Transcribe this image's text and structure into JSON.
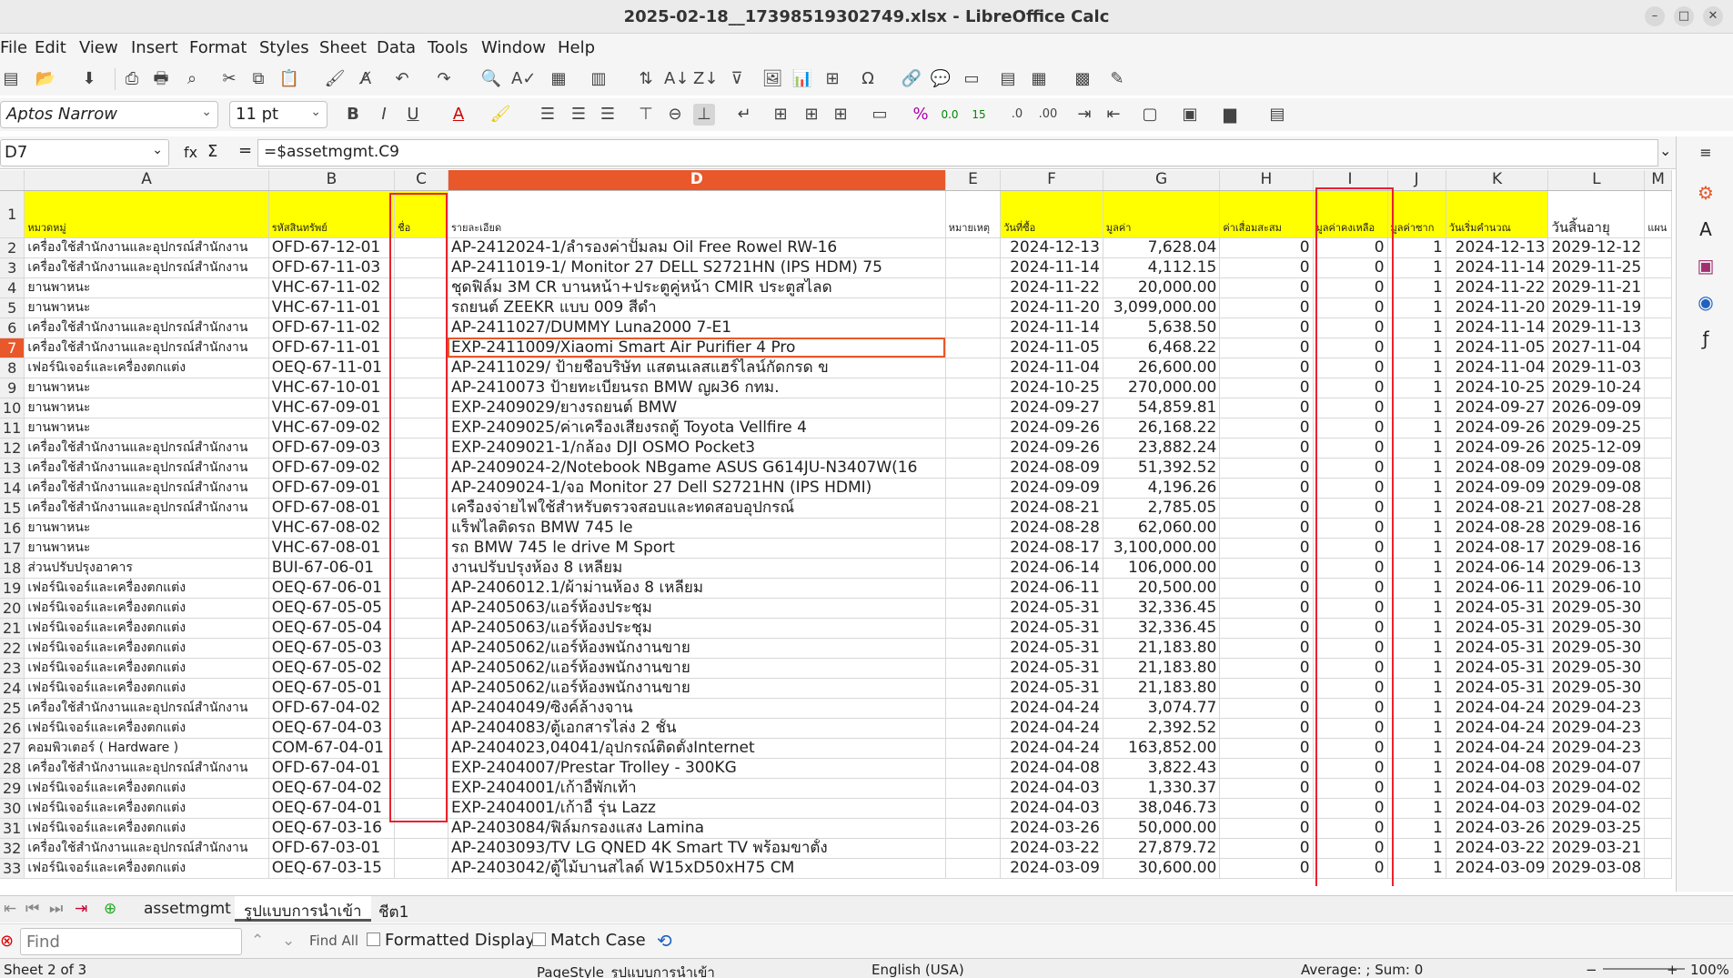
{
  "window": {
    "title": "2025-02-18__17398519302749.xlsx - LibreOffice Calc"
  },
  "menu": [
    "File",
    "Edit",
    "View",
    "Insert",
    "Format",
    "Styles",
    "Sheet",
    "Data",
    "Tools",
    "Window",
    "Help"
  ],
  "format": {
    "font_name": "Aptos Narrow",
    "font_size": "11 pt"
  },
  "formula_bar": {
    "cell_ref": "D7",
    "formula": "=$assetmgmt.C9",
    "fx": "fx",
    "sigma": "Σ",
    "equals": "="
  },
  "columns": [
    "A",
    "B",
    "C",
    "D",
    "E",
    "F",
    "G",
    "H",
    "I",
    "J",
    "K",
    "L",
    "M"
  ],
  "header_row": {
    "A": "หมวดหมู่",
    "B": "รหัสสินทรัพย์",
    "C": "ชื่อ",
    "D": "รายละเอียด",
    "E": "หมายเหตุ",
    "F": "วันที่ซื้อ",
    "G": "มูลค่า",
    "H": "ค่าเสื่อมสะสม",
    "I": "มูลค่าคงเหลือ",
    "J": "มูลค่าซาก",
    "K": "วันเริ่มคำนวณ",
    "L": "วันสิ้นอายุ",
    "M": "แผน"
  },
  "rows": [
    [
      "2",
      "เครื่องใช้สำนักงานและอุปกรณ์สำนักงาน",
      "OFD-67-12-01",
      "AP-2412024-1/ลำรองค่าปั๊มลม Oil Free Rowel RW-16",
      "2024-12-13",
      "7,628.04",
      "0",
      "0",
      "1",
      "2024-12-13",
      "2029-12-12"
    ],
    [
      "3",
      "เครื่องใช้สำนักงานและอุปกรณ์สำนักงาน",
      "OFD-67-11-03",
      "AP-2411019-1/ Monitor 27 DELL S2721HN (IPS HDM) 75",
      "2024-11-14",
      "4,112.15",
      "0",
      "0",
      "1",
      "2024-11-14",
      "2029-11-25"
    ],
    [
      "4",
      "ยานพาหนะ",
      "VHC-67-11-02",
      "ชุดฟิล์ม 3M CR บานหน้า+ประตูคู่หน้า CMIR ประตูสไลด",
      "2024-11-22",
      "20,000.00",
      "0",
      "0",
      "1",
      "2024-11-22",
      "2029-11-21"
    ],
    [
      "5",
      "ยานพาหนะ",
      "VHC-67-11-01",
      "รถยนต์ ZEEKR แบบ 009 สีดำ",
      "2024-11-20",
      "3,099,000.00",
      "0",
      "0",
      "1",
      "2024-11-20",
      "2029-11-19"
    ],
    [
      "6",
      "เครื่องใช้สำนักงานและอุปกรณ์สำนักงาน",
      "OFD-67-11-02",
      "AP-2411027/DUMMY Luna2000 7-E1",
      "2024-11-14",
      "5,638.50",
      "0",
      "0",
      "1",
      "2024-11-14",
      "2029-11-13"
    ],
    [
      "7",
      "เครื่องใช้สำนักงานและอุปกรณ์สำนักงาน",
      "OFD-67-11-01",
      "EXP-2411009/Xiaomi Smart Air Purifier 4 Pro",
      "2024-11-05",
      "6,468.22",
      "0",
      "0",
      "1",
      "2024-11-05",
      "2027-11-04"
    ],
    [
      "8",
      "เฟอร์นิเจอร์และเครื่องตกแต่ง",
      "OEQ-67-11-01",
      "AP-2411029/ ป้ายชื่อบริษัท แสตนเลสแฮร์ไลน์กัดกรด ข",
      "2024-11-04",
      "26,600.00",
      "0",
      "0",
      "1",
      "2024-11-04",
      "2029-11-03"
    ],
    [
      "9",
      "ยานพาหนะ",
      "VHC-67-10-01",
      "AP-2410073 ป้ายทะเบียนรถ BMW ญผ36 กทม.",
      "2024-10-25",
      "270,000.00",
      "0",
      "0",
      "1",
      "2024-10-25",
      "2029-10-24"
    ],
    [
      "10",
      "ยานพาหนะ",
      "VHC-67-09-01",
      "EXP-2409029/ยางรถยนต์ BMW",
      "2024-09-27",
      "54,859.81",
      "0",
      "0",
      "1",
      "2024-09-27",
      "2026-09-09"
    ],
    [
      "11",
      "ยานพาหนะ",
      "VHC-67-09-02",
      "EXP-2409025/ค่าเครื่องเสียงรถตู้ Toyota Vellfire 4",
      "2024-09-26",
      "26,168.22",
      "0",
      "0",
      "1",
      "2024-09-26",
      "2029-09-25"
    ],
    [
      "12",
      "เครื่องใช้สำนักงานและอุปกรณ์สำนักงาน",
      "OFD-67-09-03",
      "EXP-2409021-1/กล้อง DJI OSMO Pocket3",
      "2024-09-26",
      "23,882.24",
      "0",
      "0",
      "1",
      "2024-09-26",
      "2025-12-09"
    ],
    [
      "13",
      "เครื่องใช้สำนักงานและอุปกรณ์สำนักงาน",
      "OFD-67-09-02",
      "AP-2409024-2/Notebook NBgame ASUS G614JU-N3407W(16",
      "2024-08-09",
      "51,392.52",
      "0",
      "0",
      "1",
      "2024-08-09",
      "2029-09-08"
    ],
    [
      "14",
      "เครื่องใช้สำนักงานและอุปกรณ์สำนักงาน",
      "OFD-67-09-01",
      "AP-2409024-1/จอ Monitor 27 Dell S2721HN (IPS HDMI)",
      "2024-09-09",
      "4,196.26",
      "0",
      "0",
      "1",
      "2024-09-09",
      "2029-09-08"
    ],
    [
      "15",
      "เครื่องใช้สำนักงานและอุปกรณ์สำนักงาน",
      "OFD-67-08-01",
      "เครื่องจ่ายไฟใช้สำหรับตรวจสอบและทดสอบอุปกรณ์",
      "2024-08-21",
      "2,785.05",
      "0",
      "0",
      "1",
      "2024-08-21",
      "2027-08-28"
    ],
    [
      "16",
      "ยานพาหนะ",
      "VHC-67-08-02",
      "แร็ฟไลติดรถ BMW 745 le",
      "2024-08-28",
      "62,060.00",
      "0",
      "0",
      "1",
      "2024-08-28",
      "2029-08-16"
    ],
    [
      "17",
      "ยานพาหนะ",
      "VHC-67-08-01",
      "รถ BMW 745 le drive M Sport",
      "2024-08-17",
      "3,100,000.00",
      "0",
      "0",
      "1",
      "2024-08-17",
      "2029-08-16"
    ],
    [
      "18",
      "ส่วนปรับปรุงอาคาร",
      "BUI-67-06-01",
      "งานปรับปรุงห้อง 8 เหลี่ยม",
      "2024-06-14",
      "106,000.00",
      "0",
      "0",
      "1",
      "2024-06-14",
      "2029-06-13"
    ],
    [
      "19",
      "เฟอร์นิเจอร์และเครื่องตกแต่ง",
      "OEQ-67-06-01",
      "AP-2406012.1/ผ้าม่านห้อง 8 เหลี่ยม",
      "2024-06-11",
      "20,500.00",
      "0",
      "0",
      "1",
      "2024-06-11",
      "2029-06-10"
    ],
    [
      "20",
      "เฟอร์นิเจอร์และเครื่องตกแต่ง",
      "OEQ-67-05-05",
      "AP-2405063/แอร์ห้องประชุม",
      "2024-05-31",
      "32,336.45",
      "0",
      "0",
      "1",
      "2024-05-31",
      "2029-05-30"
    ],
    [
      "21",
      "เฟอร์นิเจอร์และเครื่องตกแต่ง",
      "OEQ-67-05-04",
      "AP-2405063/แอร์ห้องประชุม",
      "2024-05-31",
      "32,336.45",
      "0",
      "0",
      "1",
      "2024-05-31",
      "2029-05-30"
    ],
    [
      "22",
      "เฟอร์นิเจอร์และเครื่องตกแต่ง",
      "OEQ-67-05-03",
      "AP-2405062/แอร์ห้องพนักงานขาย",
      "2024-05-31",
      "21,183.80",
      "0",
      "0",
      "1",
      "2024-05-31",
      "2029-05-30"
    ],
    [
      "23",
      "เฟอร์นิเจอร์และเครื่องตกแต่ง",
      "OEQ-67-05-02",
      "AP-2405062/แอร์ห้องพนักงานขาย",
      "2024-05-31",
      "21,183.80",
      "0",
      "0",
      "1",
      "2024-05-31",
      "2029-05-30"
    ],
    [
      "24",
      "เฟอร์นิเจอร์และเครื่องตกแต่ง",
      "OEQ-67-05-01",
      "AP-2405062/แอร์ห้องพนักงานขาย",
      "2024-05-31",
      "21,183.80",
      "0",
      "0",
      "1",
      "2024-05-31",
      "2029-05-30"
    ],
    [
      "25",
      "เครื่องใช้สำนักงานและอุปกรณ์สำนักงาน",
      "OFD-67-04-02",
      "AP-2404049/ซิงค์ล้างจาน",
      "2024-04-24",
      "3,074.77",
      "0",
      "0",
      "1",
      "2024-04-24",
      "2029-04-23"
    ],
    [
      "26",
      "เฟอร์นิเจอร์และเครื่องตกแต่ง",
      "OEQ-67-04-03",
      "AP-2404083/ตู้เอกสารไล่ง 2 ชั้น",
      "2024-04-24",
      "2,392.52",
      "0",
      "0",
      "1",
      "2024-04-24",
      "2029-04-23"
    ],
    [
      "27",
      "คอมพิวเตอร์ ( Hardware )",
      "COM-67-04-01",
      "AP-2404023,04041/อุปกรณ์ติดตั้งInternet",
      "2024-04-24",
      "163,852.00",
      "0",
      "0",
      "1",
      "2024-04-24",
      "2029-04-23"
    ],
    [
      "28",
      "เครื่องใช้สำนักงานและอุปกรณ์สำนักงาน",
      "OFD-67-04-01",
      "EXP-2404007/Prestar Trolley - 300KG",
      "2024-04-08",
      "3,822.43",
      "0",
      "0",
      "1",
      "2024-04-08",
      "2029-04-07"
    ],
    [
      "29",
      "เฟอร์นิเจอร์และเครื่องตกแต่ง",
      "OEQ-67-04-02",
      "EXP-2404001/เก้าอี้พักเท้า",
      "2024-04-03",
      "1,330.37",
      "0",
      "0",
      "1",
      "2024-04-03",
      "2029-04-02"
    ],
    [
      "30",
      "เฟอร์นิเจอร์และเครื่องตกแต่ง",
      "OEQ-67-04-01",
      "EXP-2404001/เก้าอี้ รุ่น Lazz",
      "2024-04-03",
      "38,046.73",
      "0",
      "0",
      "1",
      "2024-04-03",
      "2029-04-02"
    ],
    [
      "31",
      "เฟอร์นิเจอร์และเครื่องตกแต่ง",
      "OEQ-67-03-16",
      "AP-2403084/ฟิล์มกรองแสง Lamina",
      "2024-03-26",
      "50,000.00",
      "0",
      "0",
      "1",
      "2024-03-26",
      "2029-03-25"
    ],
    [
      "32",
      "เครื่องใช้สำนักงานและอุปกรณ์สำนักงาน",
      "OFD-67-03-01",
      "AP-2403093/TV LG QNED 4K Smart TV พร้อมขาตั้ง",
      "2024-03-22",
      "27,879.72",
      "0",
      "0",
      "1",
      "2024-03-22",
      "2029-03-21"
    ],
    [
      "33",
      "เฟอร์นิเจอร์และเครื่องตกแต่ง",
      "OEQ-67-03-15",
      "AP-2403042/ตู้ไม้บานสไลด์ W15xD50xH75 CM",
      "2024-03-09",
      "30,600.00",
      "0",
      "0",
      "1",
      "2024-03-09",
      "2029-03-08"
    ]
  ],
  "sheet_tabs": [
    "assetmgmt",
    "รูปแบบการนำเข้า",
    "ชีต1"
  ],
  "find": {
    "placeholder": "Find",
    "find_all": "Find All",
    "formatted_display": "Formatted Display",
    "match_case": "Match Case"
  },
  "status": {
    "sheet": "Sheet 2 of 3",
    "page_style": "PageStyle_รูปแบบการนำเข้า",
    "language": "English (USA)",
    "summary": "Average: ; Sum: 0",
    "zoom": "100%"
  },
  "colors": {
    "selection": "#e8582a",
    "highlight_box": "#e8222e",
    "header_fill": "#ffff00"
  }
}
